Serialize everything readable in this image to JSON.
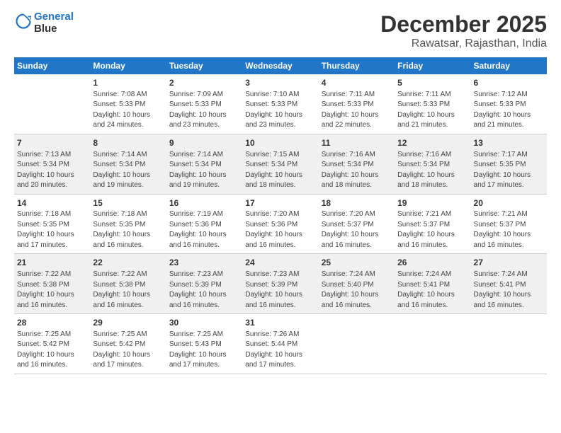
{
  "header": {
    "logo_line1": "General",
    "logo_line2": "Blue",
    "title": "December 2025",
    "subtitle": "Rawatsar, Rajasthan, India"
  },
  "days_of_week": [
    "Sunday",
    "Monday",
    "Tuesday",
    "Wednesday",
    "Thursday",
    "Friday",
    "Saturday"
  ],
  "weeks": [
    [
      {
        "day": "",
        "content": ""
      },
      {
        "day": "1",
        "content": "Sunrise: 7:08 AM\nSunset: 5:33 PM\nDaylight: 10 hours\nand 24 minutes."
      },
      {
        "day": "2",
        "content": "Sunrise: 7:09 AM\nSunset: 5:33 PM\nDaylight: 10 hours\nand 23 minutes."
      },
      {
        "day": "3",
        "content": "Sunrise: 7:10 AM\nSunset: 5:33 PM\nDaylight: 10 hours\nand 23 minutes."
      },
      {
        "day": "4",
        "content": "Sunrise: 7:11 AM\nSunset: 5:33 PM\nDaylight: 10 hours\nand 22 minutes."
      },
      {
        "day": "5",
        "content": "Sunrise: 7:11 AM\nSunset: 5:33 PM\nDaylight: 10 hours\nand 21 minutes."
      },
      {
        "day": "6",
        "content": "Sunrise: 7:12 AM\nSunset: 5:33 PM\nDaylight: 10 hours\nand 21 minutes."
      }
    ],
    [
      {
        "day": "7",
        "content": "Sunrise: 7:13 AM\nSunset: 5:34 PM\nDaylight: 10 hours\nand 20 minutes."
      },
      {
        "day": "8",
        "content": "Sunrise: 7:14 AM\nSunset: 5:34 PM\nDaylight: 10 hours\nand 19 minutes."
      },
      {
        "day": "9",
        "content": "Sunrise: 7:14 AM\nSunset: 5:34 PM\nDaylight: 10 hours\nand 19 minutes."
      },
      {
        "day": "10",
        "content": "Sunrise: 7:15 AM\nSunset: 5:34 PM\nDaylight: 10 hours\nand 18 minutes."
      },
      {
        "day": "11",
        "content": "Sunrise: 7:16 AM\nSunset: 5:34 PM\nDaylight: 10 hours\nand 18 minutes."
      },
      {
        "day": "12",
        "content": "Sunrise: 7:16 AM\nSunset: 5:34 PM\nDaylight: 10 hours\nand 18 minutes."
      },
      {
        "day": "13",
        "content": "Sunrise: 7:17 AM\nSunset: 5:35 PM\nDaylight: 10 hours\nand 17 minutes."
      }
    ],
    [
      {
        "day": "14",
        "content": "Sunrise: 7:18 AM\nSunset: 5:35 PM\nDaylight: 10 hours\nand 17 minutes."
      },
      {
        "day": "15",
        "content": "Sunrise: 7:18 AM\nSunset: 5:35 PM\nDaylight: 10 hours\nand 16 minutes."
      },
      {
        "day": "16",
        "content": "Sunrise: 7:19 AM\nSunset: 5:36 PM\nDaylight: 10 hours\nand 16 minutes."
      },
      {
        "day": "17",
        "content": "Sunrise: 7:20 AM\nSunset: 5:36 PM\nDaylight: 10 hours\nand 16 minutes."
      },
      {
        "day": "18",
        "content": "Sunrise: 7:20 AM\nSunset: 5:37 PM\nDaylight: 10 hours\nand 16 minutes."
      },
      {
        "day": "19",
        "content": "Sunrise: 7:21 AM\nSunset: 5:37 PM\nDaylight: 10 hours\nand 16 minutes."
      },
      {
        "day": "20",
        "content": "Sunrise: 7:21 AM\nSunset: 5:37 PM\nDaylight: 10 hours\nand 16 minutes."
      }
    ],
    [
      {
        "day": "21",
        "content": "Sunrise: 7:22 AM\nSunset: 5:38 PM\nDaylight: 10 hours\nand 16 minutes."
      },
      {
        "day": "22",
        "content": "Sunrise: 7:22 AM\nSunset: 5:38 PM\nDaylight: 10 hours\nand 16 minutes."
      },
      {
        "day": "23",
        "content": "Sunrise: 7:23 AM\nSunset: 5:39 PM\nDaylight: 10 hours\nand 16 minutes."
      },
      {
        "day": "24",
        "content": "Sunrise: 7:23 AM\nSunset: 5:39 PM\nDaylight: 10 hours\nand 16 minutes."
      },
      {
        "day": "25",
        "content": "Sunrise: 7:24 AM\nSunset: 5:40 PM\nDaylight: 10 hours\nand 16 minutes."
      },
      {
        "day": "26",
        "content": "Sunrise: 7:24 AM\nSunset: 5:41 PM\nDaylight: 10 hours\nand 16 minutes."
      },
      {
        "day": "27",
        "content": "Sunrise: 7:24 AM\nSunset: 5:41 PM\nDaylight: 10 hours\nand 16 minutes."
      }
    ],
    [
      {
        "day": "28",
        "content": "Sunrise: 7:25 AM\nSunset: 5:42 PM\nDaylight: 10 hours\nand 16 minutes."
      },
      {
        "day": "29",
        "content": "Sunrise: 7:25 AM\nSunset: 5:42 PM\nDaylight: 10 hours\nand 17 minutes."
      },
      {
        "day": "30",
        "content": "Sunrise: 7:25 AM\nSunset: 5:43 PM\nDaylight: 10 hours\nand 17 minutes."
      },
      {
        "day": "31",
        "content": "Sunrise: 7:26 AM\nSunset: 5:44 PM\nDaylight: 10 hours\nand 17 minutes."
      },
      {
        "day": "",
        "content": ""
      },
      {
        "day": "",
        "content": ""
      },
      {
        "day": "",
        "content": ""
      }
    ]
  ]
}
